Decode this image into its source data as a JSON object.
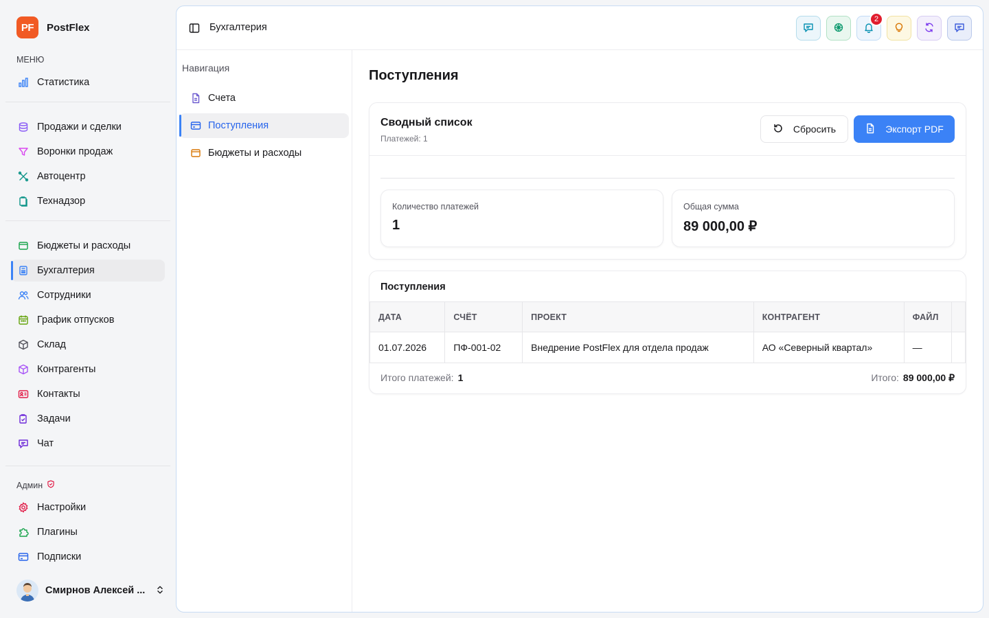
{
  "brand": {
    "logo": "PF",
    "name": "PostFlex"
  },
  "sidebar": {
    "menu_label": "МЕНЮ",
    "stats_item": {
      "label": "Статистика",
      "icon": "bar-chart-icon"
    },
    "group1": [
      {
        "label": "Продажи и сделки",
        "icon": "database-icon"
      },
      {
        "label": "Воронки продаж",
        "icon": "funnel-icon"
      },
      {
        "label": "Автоцентр",
        "icon": "wrench-icon"
      },
      {
        "label": "Технадзор",
        "icon": "clipboard-icon"
      }
    ],
    "group2": [
      {
        "label": "Бюджеты и расходы",
        "icon": "wallet-icon"
      },
      {
        "label": "Бухгалтерия",
        "icon": "calculator-icon",
        "active": true
      },
      {
        "label": "Сотрудники",
        "icon": "users-icon"
      },
      {
        "label": "График отпусков",
        "icon": "calendar-icon"
      },
      {
        "label": "Склад",
        "icon": "box-icon"
      },
      {
        "label": "Контрагенты",
        "icon": "cube-icon"
      },
      {
        "label": "Контакты",
        "icon": "contact-card-icon"
      },
      {
        "label": "Задачи",
        "icon": "tasks-icon"
      },
      {
        "label": "Чат",
        "icon": "chat-icon"
      }
    ],
    "admin_label": "Админ",
    "admin": [
      {
        "label": "Настройки",
        "icon": "gear-icon"
      },
      {
        "label": "Плагины",
        "icon": "puzzle-icon"
      },
      {
        "label": "Подписки",
        "icon": "credit-card-icon"
      }
    ],
    "user_name": "Смирнов Алексей ..."
  },
  "topbar": {
    "title": "Бухгалтерия",
    "notifications_count": "2"
  },
  "subnav": {
    "title": "Навигация",
    "items": [
      {
        "label": "Счета"
      },
      {
        "label": "Поступления"
      },
      {
        "label": "Бюджеты и расходы"
      }
    ]
  },
  "page": {
    "title": "Поступления",
    "summary": {
      "title": "Сводный список",
      "subtitle": "Платежей: 1",
      "reset_label": "Сбросить",
      "export_label": "Экспорт PDF",
      "count_label": "Количество платежей",
      "count_value": "1",
      "total_label": "Общая сумма",
      "total_value": "89 000,00 ₽"
    },
    "table": {
      "title": "Поступления",
      "columns": [
        "ДАТА",
        "СЧЁТ",
        "ПРОЕКТ",
        "КОНТРАГЕНТ",
        "ФАЙЛ"
      ],
      "rows": [
        [
          "01.07.2026",
          "ПФ-001-02",
          "Внедрение PostFlex для отдела продаж",
          "АО «Северный квартал»",
          "—"
        ]
      ],
      "footer_count_label": "Итого платежей:",
      "footer_count_value": "1",
      "footer_total_label": "Итого:",
      "footer_total_value": "89 000,00 ₽"
    }
  },
  "colors": {
    "accent": "#3b82f6",
    "brand": "#f15a24",
    "badge": "#e11d2e"
  }
}
